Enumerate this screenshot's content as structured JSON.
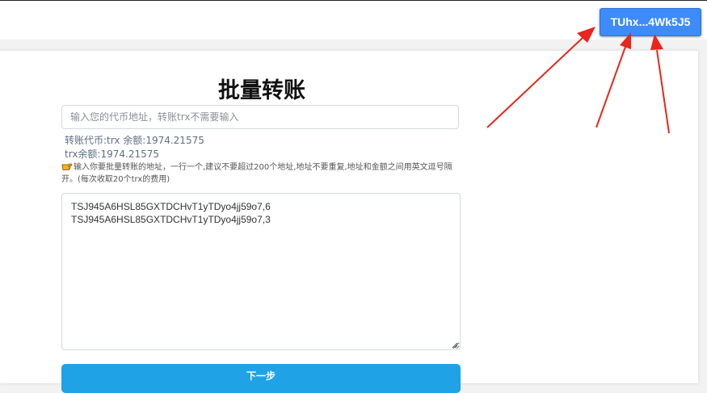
{
  "header": {
    "wallet_button_label": "TUhx...4Wk5J5"
  },
  "main": {
    "title": "批量转账",
    "address_input": {
      "value": "",
      "placeholder": "输入您的代币地址，转账trx不需要输入"
    },
    "token_info": "转账代币:trx 余额:1974.21575",
    "trx_balance": "trx余额:1974.21575",
    "hint_icon": "pointing-hand-icon",
    "hint_text": "输入你要批量转账的地址，一行一个,建议不要超过200个地址,地址不要重复,地址和金额之间用英文逗号隔开。(每次收取20个trx的费用)",
    "transfer_list": "TSJ945A6HSL85GXTDCHvT1yTDyo4jj59o7,6\nTSJ945A6HSL85GXTDCHvT1yTDyo4jj59o7,3",
    "next_button_label": "下一步"
  },
  "colors": {
    "accent_button": "#3d8bfd",
    "next_button": "#1fa2e6",
    "annotation_arrows": "#e8261c"
  }
}
